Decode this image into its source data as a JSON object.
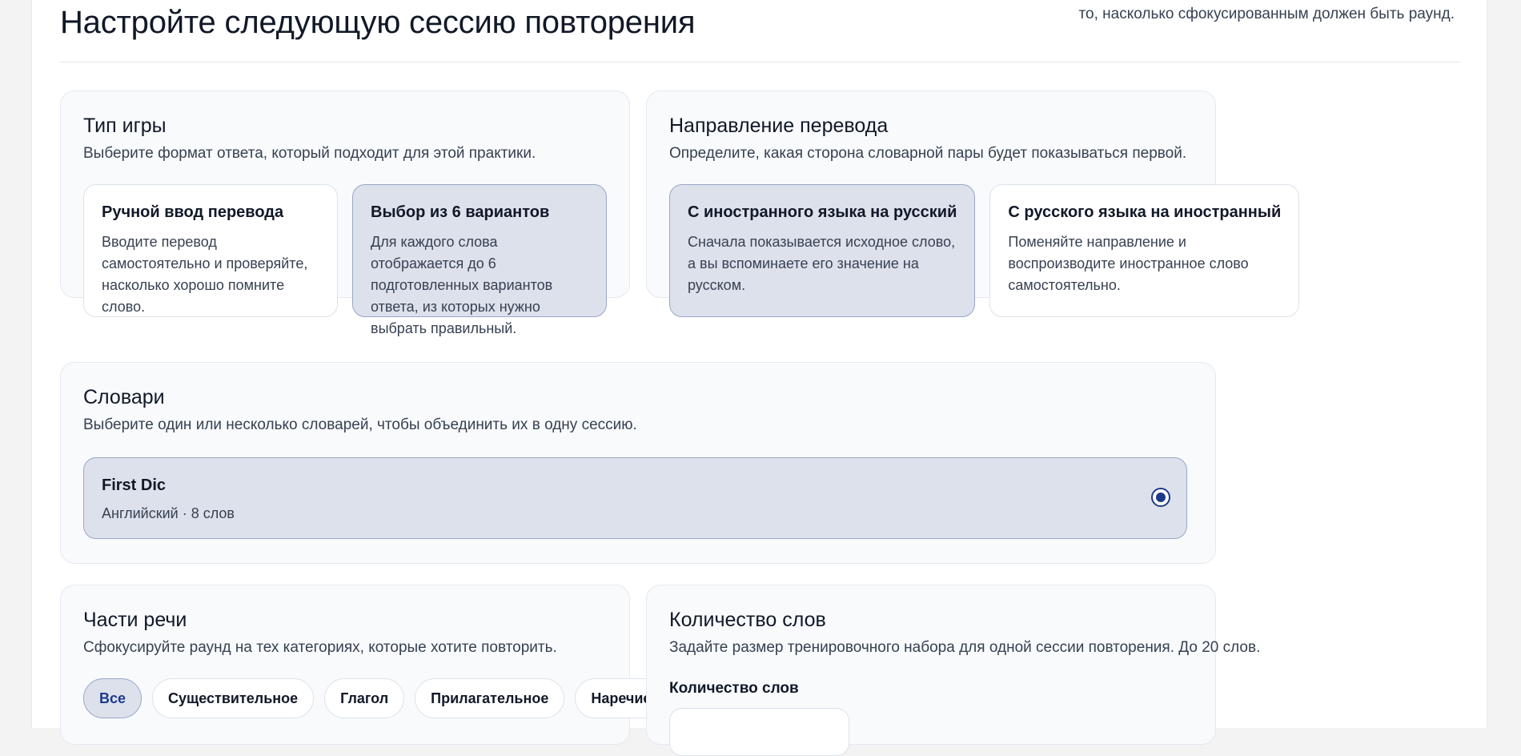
{
  "header": {
    "title": "Настройте следующую сессию повторения",
    "hint": "то, насколько сфокусированным должен быть раунд."
  },
  "game_type": {
    "title": "Тип игры",
    "description": "Выберите формат ответа, который подходит для этой практики.",
    "options": [
      {
        "title": "Ручной ввод перевода",
        "description": "Вводите перевод самостоятельно и проверяйте, насколько хорошо помните слово.",
        "selected": false
      },
      {
        "title": "Выбор из 6 вариантов",
        "description": "Для каждого слова отображается до 6 подготовленных вариантов ответа, из которых нужно выбрать правильный.",
        "selected": true
      }
    ]
  },
  "direction": {
    "title": "Направление перевода",
    "description": "Определите, какая сторона словарной пары будет показываться первой.",
    "options": [
      {
        "title": "С иностранного языка на русский",
        "description": "Сначала показывается исходное слово, а вы вспоминаете его значение на русском.",
        "selected": true
      },
      {
        "title": "С русского языка на иностранный",
        "description": "Поменяйте направление и воспроизводите иностранное слово самостоятельно.",
        "selected": false
      }
    ]
  },
  "dictionaries": {
    "title": "Словари",
    "description": "Выберите один или несколько словарей, чтобы объединить их в одну сессию.",
    "items": [
      {
        "name": "First Dic",
        "meta": "Английский · 8 слов",
        "selected": true
      }
    ]
  },
  "parts_of_speech": {
    "title": "Части речи",
    "description": "Сфокусируйте раунд на тех категориях, которые хотите повторить.",
    "chips": [
      {
        "label": "Все",
        "active": true
      },
      {
        "label": "Существительное",
        "active": false
      },
      {
        "label": "Глагол",
        "active": false
      },
      {
        "label": "Прилагательное",
        "active": false
      },
      {
        "label": "Наречие",
        "active": false
      }
    ]
  },
  "word_count": {
    "title": "Количество слов",
    "description": "Задайте размер тренировочного набора для одной сессии повторения. До 20 слов.",
    "field_label": "Количество слов",
    "value": ""
  },
  "colors": {
    "accent": "#1e3a8a",
    "selected_bg": "#dde1ec",
    "selected_border": "#9aa6c7",
    "panel_bg": "#f8fafc"
  }
}
